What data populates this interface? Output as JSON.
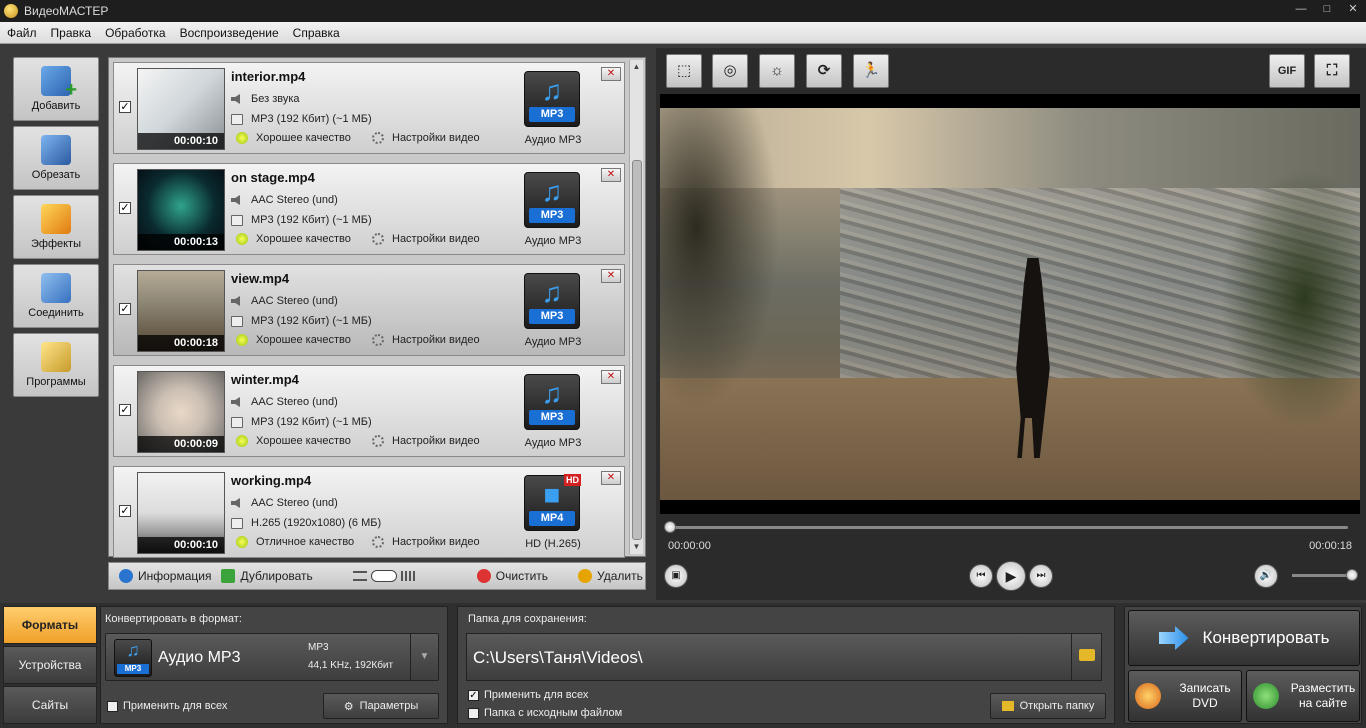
{
  "window": {
    "title": "ВидеоМАСТЕР",
    "controls": [
      "—",
      "□",
      "✕"
    ]
  },
  "menu": [
    "Файл",
    "Правка",
    "Обработка",
    "Воспроизведение",
    "Справка"
  ],
  "tools": [
    {
      "label": "Добавить",
      "icon": "add-video-icon"
    },
    {
      "label": "Обрезать",
      "icon": "cut-icon"
    },
    {
      "label": "Эффекты",
      "icon": "effects-icon"
    },
    {
      "label": "Соединить",
      "icon": "join-icon"
    },
    {
      "label": "Программы",
      "icon": "programs-icon"
    }
  ],
  "files": [
    {
      "name": "interior.mp4",
      "audio": "Без звука",
      "output": "MP3 (192 Кбит) (~1 МБ)",
      "duration": "00:00:10",
      "quality": "Хорошее качество",
      "settings": "Настройки видео",
      "format_badge": "MP3",
      "format_name": "Аудио MP3",
      "checked": true
    },
    {
      "name": "on stage.mp4",
      "audio": "AAC Stereo (und)",
      "output": "MP3 (192 Кбит) (~1 МБ)",
      "duration": "00:00:13",
      "quality": "Хорошее качество",
      "settings": "Настройки видео",
      "format_badge": "MP3",
      "format_name": "Аудио MP3",
      "checked": true
    },
    {
      "name": "view.mp4",
      "audio": "AAC Stereo (und)",
      "output": "MP3 (192 Кбит) (~1 МБ)",
      "duration": "00:00:18",
      "quality": "Хорошее качество",
      "settings": "Настройки видео",
      "format_badge": "MP3",
      "format_name": "Аудио MP3",
      "checked": true
    },
    {
      "name": "winter.mp4",
      "audio": "AAC Stereo (und)",
      "output": "MP3 (192 Кбит) (~1 МБ)",
      "duration": "00:00:09",
      "quality": "Хорошее качество",
      "settings": "Настройки видео",
      "format_badge": "MP3",
      "format_name": "Аудио MP3",
      "checked": true
    },
    {
      "name": "working.mp4",
      "audio": "AAC Stereo (und)",
      "output": "H.265 (1920x1080) (6 МБ)",
      "duration": "00:00:10",
      "quality": "Отличное качество",
      "settings": "Настройки видео",
      "format_badge": "MP4",
      "format_name": "HD (H.265)",
      "hd_badge": "HD",
      "checked": true
    }
  ],
  "list_footer": {
    "info": "Информация",
    "duplicate": "Дублировать",
    "clear": "Очистить",
    "delete": "Удалить"
  },
  "preview_tools": [
    {
      "icon": "crop-icon",
      "glyph": "⬚"
    },
    {
      "icon": "watermark-icon",
      "glyph": "◎"
    },
    {
      "icon": "brightness-icon",
      "glyph": "☼"
    },
    {
      "icon": "rotate-icon",
      "glyph": "⟳"
    },
    {
      "icon": "speed-icon",
      "glyph": "🏃"
    }
  ],
  "preview_right_tools": [
    {
      "icon": "gif-icon",
      "glyph": "GIF"
    },
    {
      "icon": "fullscreen-icon",
      "glyph": "⛶"
    }
  ],
  "player": {
    "time_current": "00:00:00",
    "time_total": "00:00:18",
    "progress": 0,
    "volume": 1.0
  },
  "tabs": [
    "Форматы",
    "Устройства",
    "Сайты"
  ],
  "convert": {
    "label": "Конвертировать в формат:",
    "format_name": "Аудио MP3",
    "format_badge": "MP3",
    "detail1": "MP3",
    "detail2": "44,1 KHz, 192Кбит",
    "apply_all": "Применить для всех",
    "params": "Параметры"
  },
  "save": {
    "label": "Папка для сохранения:",
    "path": "C:\\Users\\Таня\\Videos\\",
    "apply_all": "Применить для всех",
    "source_folder": "Папка с исходным файлом",
    "open_folder": "Открыть папку"
  },
  "actions": {
    "convert": "Конвертировать",
    "dvd_l1": "Записать",
    "dvd_l2": "DVD",
    "web_l1": "Разместить",
    "web_l2": "на сайте"
  }
}
